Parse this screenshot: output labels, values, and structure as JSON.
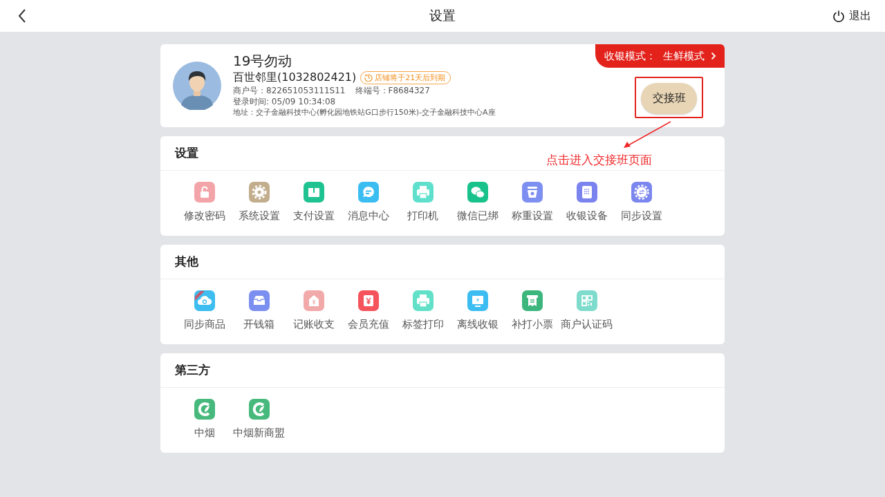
{
  "top_bar": {
    "title": "设置",
    "logout": "退出"
  },
  "profile": {
    "name": "19号勿动",
    "store": "百世邻里(1032802421)",
    "expiry_badge": "店铺将于21天后到期",
    "merchant_no": "商户号：822651053111S11",
    "terminal_no": "终端号：F8684327",
    "login_time": "登录时间: 05/09 10:34:08",
    "address": "地址：交子金融科技中心(孵化园地铁站G口步行150米)-交子金融科技中心A座",
    "mode_badge": "收银模式：  生鲜模式",
    "handover_button": "交接班"
  },
  "annotation": {
    "text": "点击进入交接班页面"
  },
  "sections": [
    {
      "title": "设置",
      "items": [
        {
          "label": "修改密码",
          "kind": "lock",
          "color": "#f3a4a8"
        },
        {
          "label": "系统设置",
          "kind": "gear",
          "color": "#c2ad8c"
        },
        {
          "label": "支付设置",
          "kind": "box",
          "color": "#1fc291"
        },
        {
          "label": "消息中心",
          "kind": "chat",
          "color": "#3bbdf2"
        },
        {
          "label": "打印机",
          "kind": "printer",
          "color": "#5fe0cc"
        },
        {
          "label": "微信已绑",
          "kind": "wechat",
          "color": "#18c28a"
        },
        {
          "label": "称重设置",
          "kind": "scale",
          "color": "#7d8ff0"
        },
        {
          "label": "收银设备",
          "kind": "register",
          "color": "#7b83ef"
        },
        {
          "label": "同步设置",
          "kind": "sync",
          "color": "#7b86ee"
        }
      ]
    },
    {
      "title": "其他",
      "items": [
        {
          "label": "同步商品",
          "kind": "cloud",
          "color": "#3dbdf0"
        },
        {
          "label": "开钱箱",
          "kind": "drawer",
          "color": "#7b8ff0"
        },
        {
          "label": "记账收支",
          "kind": "house",
          "color": "#f2a9a9"
        },
        {
          "label": "会员充值",
          "kind": "yen",
          "color": "#f5545c"
        },
        {
          "label": "标签打印",
          "kind": "printer",
          "color": "#62e0c8"
        },
        {
          "label": "离线收银",
          "kind": "monitor",
          "color": "#3bbdf2"
        },
        {
          "label": "补打小票",
          "kind": "receipt",
          "color": "#3db67d"
        },
        {
          "label": "商户认证码",
          "kind": "qr",
          "color": "#7fdccc"
        }
      ]
    },
    {
      "title": "第三方",
      "items": [
        {
          "label": "中烟",
          "kind": "leaf",
          "color": "#47b97c"
        },
        {
          "label": "中烟新商盟",
          "kind": "leaf",
          "color": "#47b97c"
        }
      ]
    }
  ]
}
